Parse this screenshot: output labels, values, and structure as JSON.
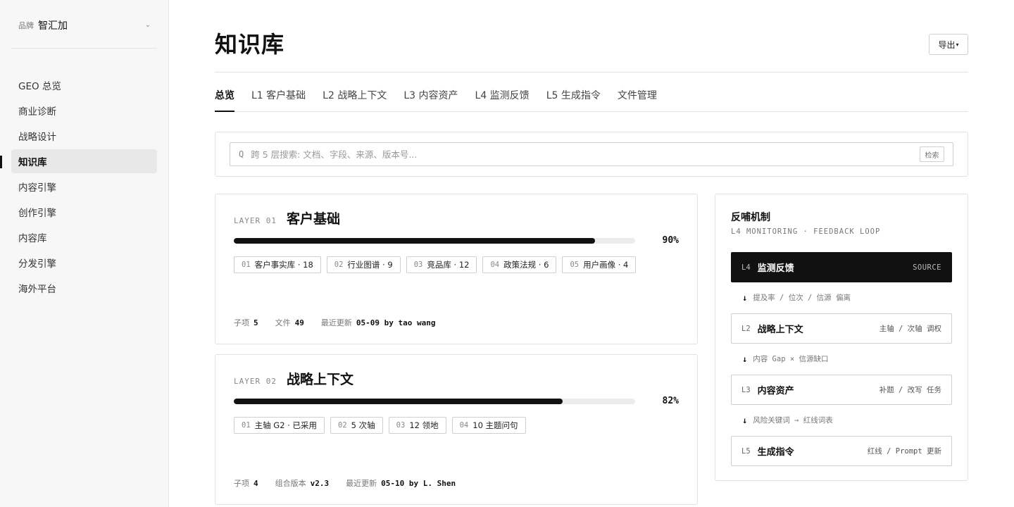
{
  "sidebar": {
    "brand": {
      "tag": "品牌",
      "name": "智汇加",
      "chevron": "⌄"
    },
    "items": [
      {
        "label": "GEO 总览"
      },
      {
        "label": "商业诊断"
      },
      {
        "label": "战略设计"
      },
      {
        "label": "知识库",
        "active": true
      },
      {
        "label": "内容引擎"
      },
      {
        "label": "创作引擎"
      },
      {
        "label": "内容库"
      },
      {
        "label": "分发引擎"
      },
      {
        "label": "海外平台"
      }
    ]
  },
  "header": {
    "title": "知识库",
    "export_label": "导出",
    "export_caret": "▾"
  },
  "tabs": [
    {
      "label": "总览",
      "active": true
    },
    {
      "label": "L1 客户基础"
    },
    {
      "label": "L2 战略上下文"
    },
    {
      "label": "L3 内容资产"
    },
    {
      "label": "L4 监测反馈"
    },
    {
      "label": "L5 生成指令"
    },
    {
      "label": "文件管理"
    }
  ],
  "search": {
    "icon": "Q",
    "placeholder": "跨 5 层搜索: 文档、字段、来源、版本号...",
    "value": "",
    "button_label": "检索"
  },
  "layers": [
    {
      "kicker": "LAYER 01",
      "name": "客户基础",
      "progress": 0.9,
      "progress_label": "90%",
      "chips": [
        {
          "num": "01",
          "label": "客户事实库 · 18"
        },
        {
          "num": "02",
          "label": "行业图谱 · 9"
        },
        {
          "num": "03",
          "label": "竞品库 · 12"
        },
        {
          "num": "04",
          "label": "政策法规 · 6"
        },
        {
          "num": "05",
          "label": "用户画像 · 4"
        }
      ],
      "footer": [
        {
          "label": "子项",
          "value": "5"
        },
        {
          "label": "文件",
          "value": "49"
        },
        {
          "label": "最近更新",
          "value": "05-09 by tao wang"
        }
      ]
    },
    {
      "kicker": "LAYER 02",
      "name": "战略上下文",
      "progress": 0.82,
      "progress_label": "82%",
      "chips": [
        {
          "num": "01",
          "label": "主轴 G2 · 已采用"
        },
        {
          "num": "02",
          "label": "5 次轴"
        },
        {
          "num": "03",
          "label": "12 领地"
        },
        {
          "num": "04",
          "label": "10 主题问句"
        }
      ],
      "footer": [
        {
          "label": "子项",
          "value": "4"
        },
        {
          "label": "组合版本",
          "value": "v2.3"
        },
        {
          "label": "最近更新",
          "value": "05-10 by L. Shen"
        }
      ]
    }
  ],
  "feedback": {
    "title": "反哺机制",
    "subtitle": "L4 MONITORING · FEEDBACK LOOP",
    "nodes": [
      {
        "code": "L4",
        "name": "监测反馈",
        "meta": "SOURCE",
        "dark": true
      },
      {
        "code": "L2",
        "name": "战略上下文",
        "meta": "主轴 / 次轴 调权"
      },
      {
        "code": "L3",
        "name": "内容资产",
        "meta": "补题 / 改写 任务"
      },
      {
        "code": "L5",
        "name": "生成指令",
        "meta": "红线 / Prompt 更新"
      }
    ],
    "arrows": [
      {
        "icon": "↓",
        "text": "提及率 / 位次 / 信源 偏离"
      },
      {
        "icon": "↓",
        "text": "内容 Gap × 信源缺口"
      },
      {
        "icon": "↓",
        "text": "风险关键词 → 红线词表"
      }
    ]
  }
}
